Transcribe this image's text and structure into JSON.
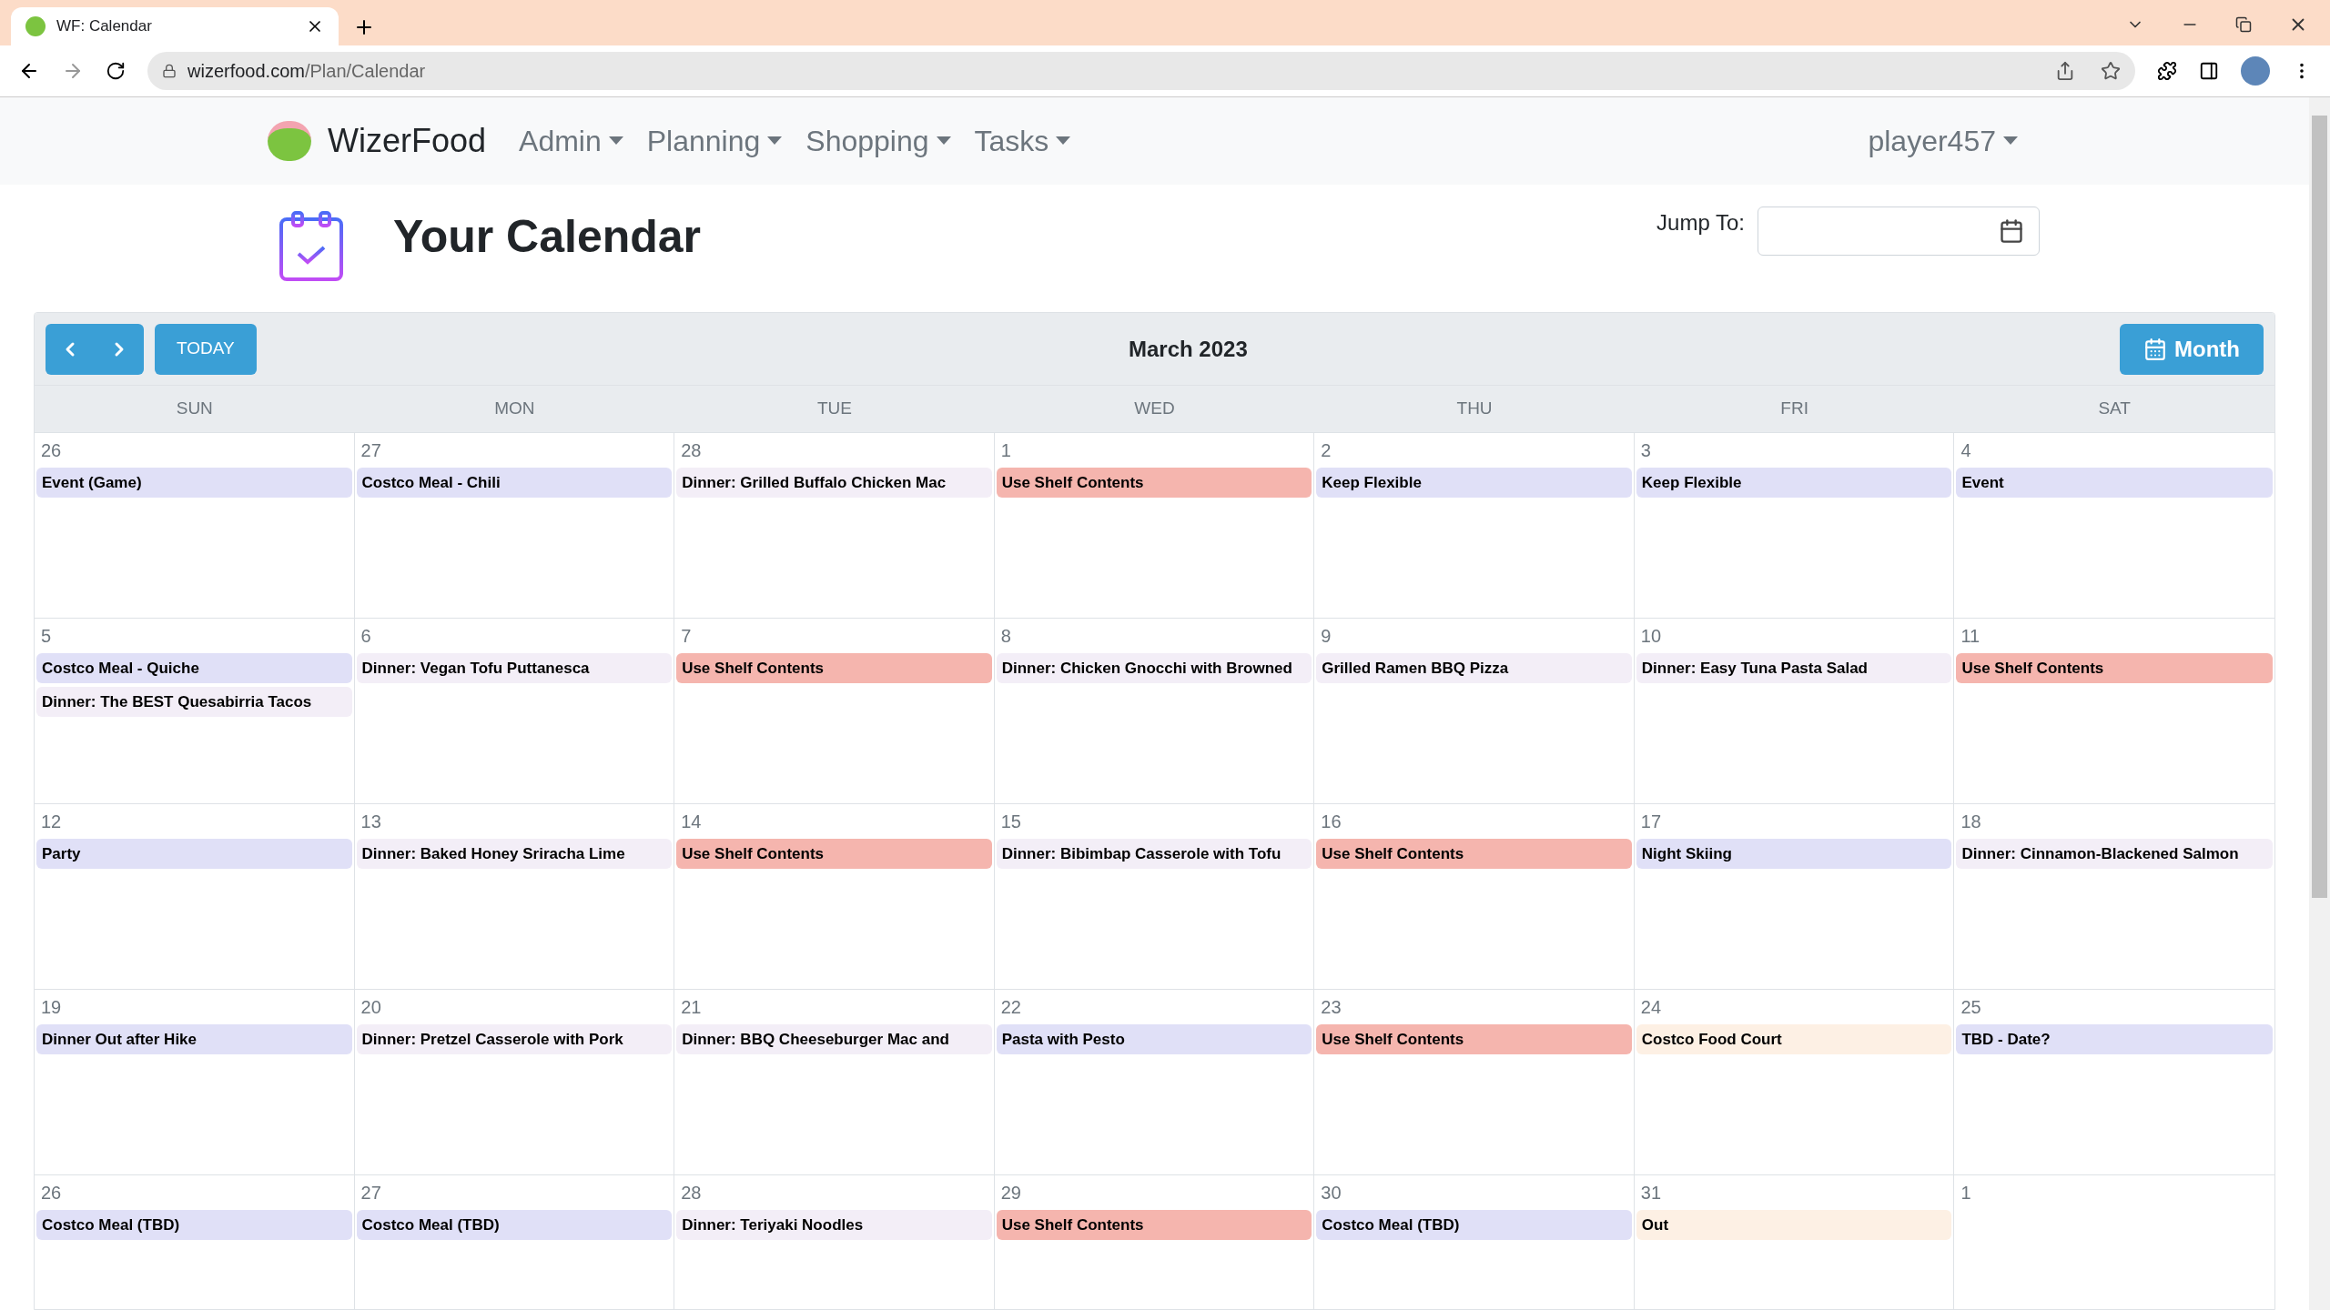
{
  "browser": {
    "tab_title": "WF: Calendar",
    "url_host": "wizerfood.com",
    "url_path": "/Plan/Calendar"
  },
  "navbar": {
    "brand": "WizerFood",
    "menus": [
      "Admin",
      "Planning",
      "Shopping",
      "Tasks"
    ],
    "user": "player457"
  },
  "page": {
    "title": "Your Calendar",
    "jump_label": "Jump To:"
  },
  "calendar": {
    "title": "March 2023",
    "today_button": "TODAY",
    "view_button": "Month",
    "weekdays": [
      "SUN",
      "MON",
      "TUE",
      "WED",
      "THU",
      "FRI",
      "SAT"
    ],
    "weeks": [
      [
        {
          "day": "26",
          "events": [
            {
              "title": "Event (Game)",
              "color": "#e0e0f7"
            }
          ]
        },
        {
          "day": "27",
          "events": [
            {
              "title": "Costco Meal - Chili",
              "color": "#e0e0f7"
            }
          ]
        },
        {
          "day": "28",
          "events": [
            {
              "title": "Dinner: Grilled Buffalo Chicken Mac",
              "color": "#f3eef7"
            }
          ]
        },
        {
          "day": "1",
          "events": [
            {
              "title": "Use Shelf Contents",
              "color": "#f5b5ae"
            }
          ]
        },
        {
          "day": "2",
          "events": [
            {
              "title": "Keep Flexible",
              "color": "#e0e0f7"
            }
          ]
        },
        {
          "day": "3",
          "events": [
            {
              "title": "Keep Flexible",
              "color": "#e0e0f7"
            }
          ]
        },
        {
          "day": "4",
          "events": [
            {
              "title": "Event",
              "color": "#e0e0f7"
            }
          ]
        }
      ],
      [
        {
          "day": "5",
          "events": [
            {
              "title": "Costco Meal - Quiche",
              "color": "#e0e0f7"
            },
            {
              "title": "Dinner: The BEST Quesabirria Tacos",
              "color": "#f3eef7"
            }
          ]
        },
        {
          "day": "6",
          "events": [
            {
              "title": "Dinner: Vegan Tofu Puttanesca",
              "color": "#f3eef7"
            }
          ]
        },
        {
          "day": "7",
          "events": [
            {
              "title": "Use Shelf Contents",
              "color": "#f5b5ae"
            }
          ]
        },
        {
          "day": "8",
          "events": [
            {
              "title": "Dinner: Chicken Gnocchi with Browned",
              "color": "#f3eef7"
            }
          ]
        },
        {
          "day": "9",
          "events": [
            {
              "title": "Grilled Ramen BBQ Pizza",
              "color": "#f3eef7"
            }
          ]
        },
        {
          "day": "10",
          "events": [
            {
              "title": "Dinner: Easy Tuna Pasta Salad",
              "color": "#f3eef7"
            }
          ]
        },
        {
          "day": "11",
          "events": [
            {
              "title": "Use Shelf Contents",
              "color": "#f5b5ae"
            }
          ]
        }
      ],
      [
        {
          "day": "12",
          "events": [
            {
              "title": "Party",
              "color": "#e0e0f7"
            }
          ]
        },
        {
          "day": "13",
          "events": [
            {
              "title": "Dinner: Baked Honey Sriracha Lime",
              "color": "#f3eef7"
            }
          ]
        },
        {
          "day": "14",
          "events": [
            {
              "title": "Use Shelf Contents",
              "color": "#f5b5ae"
            }
          ]
        },
        {
          "day": "15",
          "events": [
            {
              "title": "Dinner: Bibimbap Casserole with Tofu",
              "color": "#f3eef7"
            }
          ]
        },
        {
          "day": "16",
          "events": [
            {
              "title": "Use Shelf Contents",
              "color": "#f5b5ae"
            }
          ]
        },
        {
          "day": "17",
          "events": [
            {
              "title": "Night Skiing",
              "color": "#e0e0f7"
            }
          ]
        },
        {
          "day": "18",
          "events": [
            {
              "title": "Dinner: Cinnamon-Blackened Salmon",
              "color": "#f3eef7"
            }
          ]
        }
      ],
      [
        {
          "day": "19",
          "events": [
            {
              "title": "Dinner Out after Hike",
              "color": "#e0e0f7"
            }
          ]
        },
        {
          "day": "20",
          "events": [
            {
              "title": "Dinner: Pretzel Casserole with Pork",
              "color": "#f3eef7"
            }
          ]
        },
        {
          "day": "21",
          "events": [
            {
              "title": "Dinner: BBQ Cheeseburger Mac and",
              "color": "#f3eef7"
            }
          ]
        },
        {
          "day": "22",
          "events": [
            {
              "title": "Pasta with Pesto",
              "color": "#e0e0f7"
            }
          ]
        },
        {
          "day": "23",
          "events": [
            {
              "title": "Use Shelf Contents",
              "color": "#f5b5ae"
            }
          ]
        },
        {
          "day": "24",
          "events": [
            {
              "title": "Costco Food Court",
              "color": "#fdf0e4"
            }
          ]
        },
        {
          "day": "25",
          "events": [
            {
              "title": "TBD - Date?",
              "color": "#e0e0f7"
            }
          ]
        }
      ],
      [
        {
          "day": "26",
          "events": [
            {
              "title": "Costco Meal (TBD)",
              "color": "#e0e0f7"
            }
          ]
        },
        {
          "day": "27",
          "events": [
            {
              "title": "Costco Meal (TBD)",
              "color": "#e0e0f7"
            }
          ]
        },
        {
          "day": "28",
          "events": [
            {
              "title": "Dinner: Teriyaki Noodles",
              "color": "#f3eef7"
            }
          ]
        },
        {
          "day": "29",
          "events": [
            {
              "title": "Use Shelf Contents",
              "color": "#f5b5ae"
            }
          ]
        },
        {
          "day": "30",
          "events": [
            {
              "title": "Costco Meal (TBD)",
              "color": "#e0e0f7"
            }
          ]
        },
        {
          "day": "31",
          "events": [
            {
              "title": "Out",
              "color": "#fdf0e4"
            }
          ]
        },
        {
          "day": "1"
        }
      ]
    ]
  }
}
